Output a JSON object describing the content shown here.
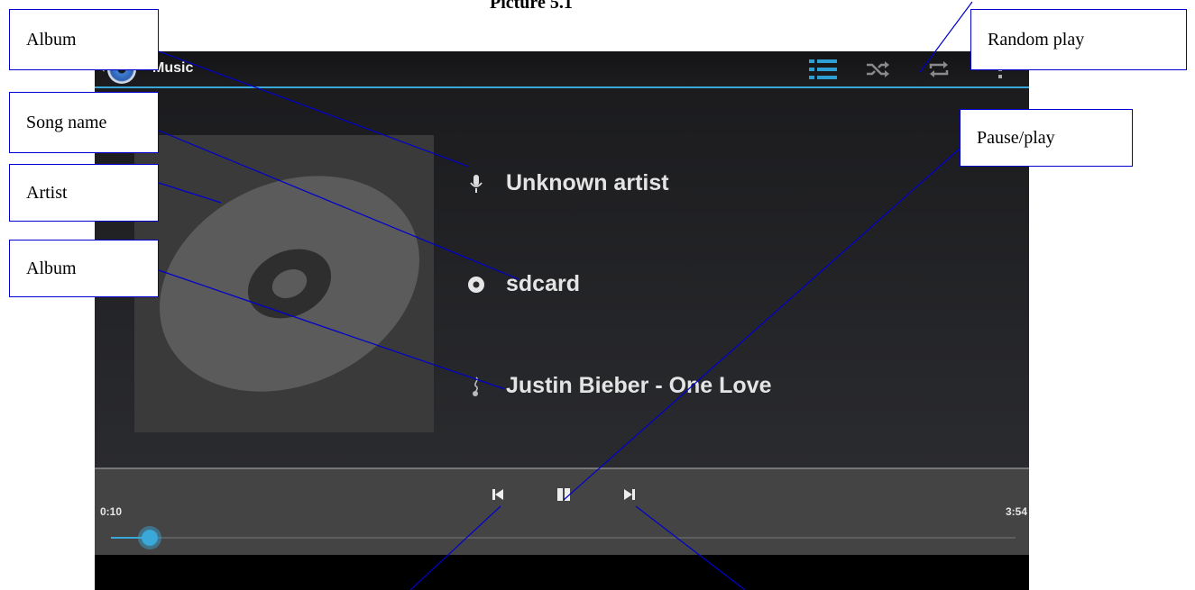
{
  "document": {
    "caption": "Picture 5.1"
  },
  "player": {
    "app_title": "Music",
    "artist": "Unknown artist",
    "album": "sdcard",
    "song": "Justin Bieber - One Love",
    "elapsed": "0:10",
    "duration": "3:54",
    "progress_fraction": 0.043,
    "accent_color": "#3aa8d8"
  },
  "callouts": {
    "album_top": "Album",
    "song_name": "Song name",
    "artist": "Artist",
    "album_second": "Album",
    "random_play": "Random play",
    "pause_play": "Pause/play"
  },
  "icons": [
    "back-chevron-icon",
    "app-logo-icon",
    "playlist-icon",
    "shuffle-icon",
    "repeat-icon",
    "overflow-menu-icon",
    "microphone-icon",
    "disc-icon",
    "music-note-icon",
    "previous-icon",
    "pause-icon",
    "next-icon"
  ]
}
